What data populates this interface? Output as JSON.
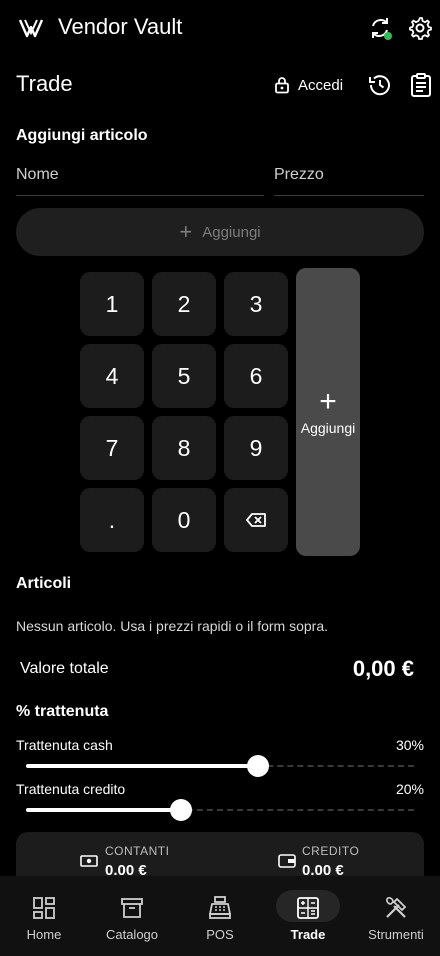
{
  "app": {
    "title": "Vendor Vault"
  },
  "page": {
    "title": "Trade",
    "login_label": "Accedi"
  },
  "add_item": {
    "title": "Aggiungi articolo",
    "name_placeholder": "Nome",
    "price_placeholder": "Prezzo",
    "add_button": "Aggiungi"
  },
  "keypad": {
    "keys": [
      "1",
      "2",
      "3",
      "4",
      "5",
      "6",
      "7",
      "8",
      "9",
      ".",
      "0"
    ],
    "add_label": "Aggiungi"
  },
  "items": {
    "title": "Articoli",
    "empty_message": "Nessun articolo. Usa i prezzi rapidi o il form sopra."
  },
  "total": {
    "label": "Valore totale",
    "value": "0,00 €"
  },
  "retention": {
    "title": "% trattenuta",
    "cash": {
      "label": "Trattenuta cash",
      "percent_label": "30%",
      "value": 0.3
    },
    "credit": {
      "label": "Trattenuta credito",
      "percent_label": "20%",
      "value": 0.2
    }
  },
  "summary": {
    "cash": {
      "label": "CONTANTI",
      "value": "0.00 €"
    },
    "credit": {
      "label": "CREDITO",
      "value": "0.00 €"
    }
  },
  "nav": {
    "active": "Trade",
    "items": [
      {
        "label": "Home",
        "icon": "dashboard-icon"
      },
      {
        "label": "Catalogo",
        "icon": "archive-icon"
      },
      {
        "label": "POS",
        "icon": "cash-register-icon"
      },
      {
        "label": "Trade",
        "icon": "calculator-icon"
      },
      {
        "label": "Strumenti",
        "icon": "tools-icon"
      }
    ]
  }
}
